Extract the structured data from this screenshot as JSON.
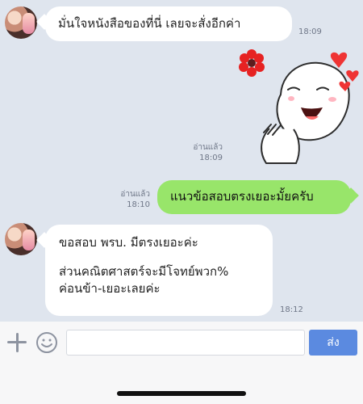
{
  "messages": [
    {
      "text": "มั่นใจหนังสือของที่นี่ เลยจะสั่งอีกค่า",
      "time": "18:09"
    },
    {
      "read": "อ่านแล้ว",
      "time": "18:09"
    },
    {
      "read": "อ่านแล้ว",
      "time": "18:10",
      "text": "แนวข้อสอบตรงเยอะมั้ยครับ"
    },
    {
      "text_line1": "ขอสอบ พรบ. มีตรงเยอะค่ะ",
      "text_line2": "ส่วนคณิตศาสตร์จะมีโจทย์พวก%",
      "text_line3": "ค่อนข้า-เยอะเลยค่ะ",
      "time": "18:12"
    }
  ],
  "input": {
    "placeholder": "",
    "send_label": "ส่ง"
  },
  "icons": {
    "plus": "plus-icon",
    "emoji": "emoji-icon",
    "sticker": "sticker"
  },
  "colors": {
    "outgoing": "#98e56a",
    "incoming": "#ffffff",
    "send": "#5b8ae0"
  }
}
